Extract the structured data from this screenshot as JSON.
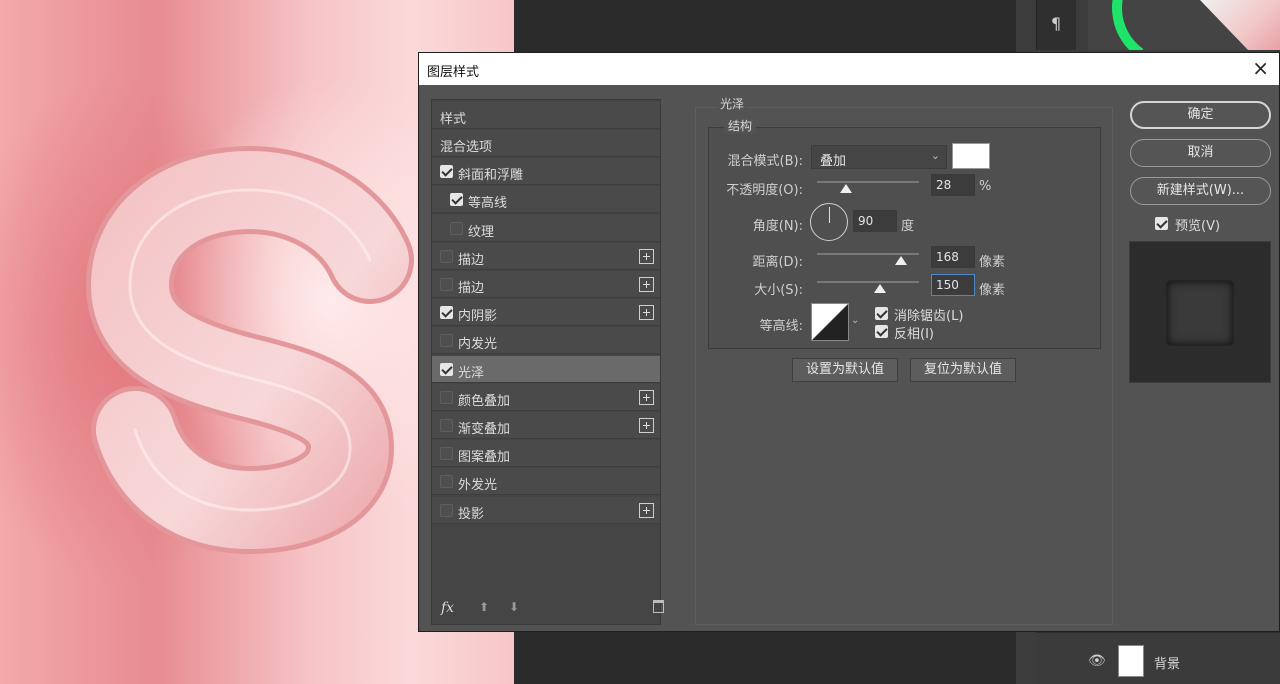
{
  "dialog": {
    "title": "图层样式",
    "close_label": "×"
  },
  "style_list": {
    "header": "样式",
    "items": [
      {
        "label": "混合选项",
        "has_checkbox": false,
        "checked": false,
        "has_plus": false,
        "selected": false
      },
      {
        "label": "斜面和浮雕",
        "has_checkbox": true,
        "checked": true,
        "has_plus": false,
        "selected": false
      },
      {
        "label": "等高线",
        "has_checkbox": true,
        "checked": true,
        "has_plus": false,
        "selected": false,
        "indent": true
      },
      {
        "label": "纹理",
        "has_checkbox": true,
        "checked": false,
        "has_plus": false,
        "selected": false,
        "indent": true
      },
      {
        "label": "描边",
        "has_checkbox": true,
        "checked": false,
        "has_plus": true,
        "selected": false
      },
      {
        "label": "描边",
        "has_checkbox": true,
        "checked": false,
        "has_plus": true,
        "selected": false
      },
      {
        "label": "内阴影",
        "has_checkbox": true,
        "checked": true,
        "has_plus": true,
        "selected": false
      },
      {
        "label": "内发光",
        "has_checkbox": true,
        "checked": false,
        "has_plus": false,
        "selected": false
      },
      {
        "label": "光泽",
        "has_checkbox": true,
        "checked": true,
        "has_plus": false,
        "selected": true
      },
      {
        "label": "颜色叠加",
        "has_checkbox": true,
        "checked": false,
        "has_plus": true,
        "selected": false
      },
      {
        "label": "渐变叠加",
        "has_checkbox": true,
        "checked": false,
        "has_plus": true,
        "selected": false
      },
      {
        "label": "图案叠加",
        "has_checkbox": true,
        "checked": false,
        "has_plus": false,
        "selected": false
      },
      {
        "label": "外发光",
        "has_checkbox": true,
        "checked": false,
        "has_plus": false,
        "selected": false
      },
      {
        "label": "投影",
        "has_checkbox": true,
        "checked": false,
        "has_plus": true,
        "selected": false
      }
    ],
    "footer": {
      "fx_label": "fx",
      "up_glyph": "⬆",
      "down_glyph": "⬇"
    }
  },
  "satin": {
    "group_title": "光泽",
    "structure_title": "结构",
    "blend_mode_label": "混合模式(B):",
    "blend_mode_value": "叠加",
    "blend_color": "#ffffff",
    "opacity_label": "不透明度(O):",
    "opacity_value": "28",
    "opacity_unit": "%",
    "opacity_fraction": 0.28,
    "angle_label": "角度(N):",
    "angle_value": "90",
    "angle_unit": "度",
    "distance_label": "距离(D):",
    "distance_value": "168",
    "distance_unit": "像素",
    "distance_fraction": 0.82,
    "size_label": "大小(S):",
    "size_value": "150",
    "size_unit": "像素",
    "size_fraction": 0.62,
    "contour_label": "等高线:",
    "anti_alias_label": "消除锯齿(L)",
    "anti_alias_checked": true,
    "invert_label": "反相(I)",
    "invert_checked": true,
    "make_default_label": "设置为默认值",
    "reset_default_label": "复位为默认值"
  },
  "buttons": {
    "ok": "确定",
    "cancel": "取消",
    "new_style": "新建样式(W)...",
    "preview_label": "预览(V)",
    "preview_checked": true
  },
  "layers": {
    "background_layer": "背景"
  },
  "colors": {
    "dialog_bg": "#535353",
    "selected_row": "#6a6a6a",
    "accent_green": "#1ee46a"
  }
}
